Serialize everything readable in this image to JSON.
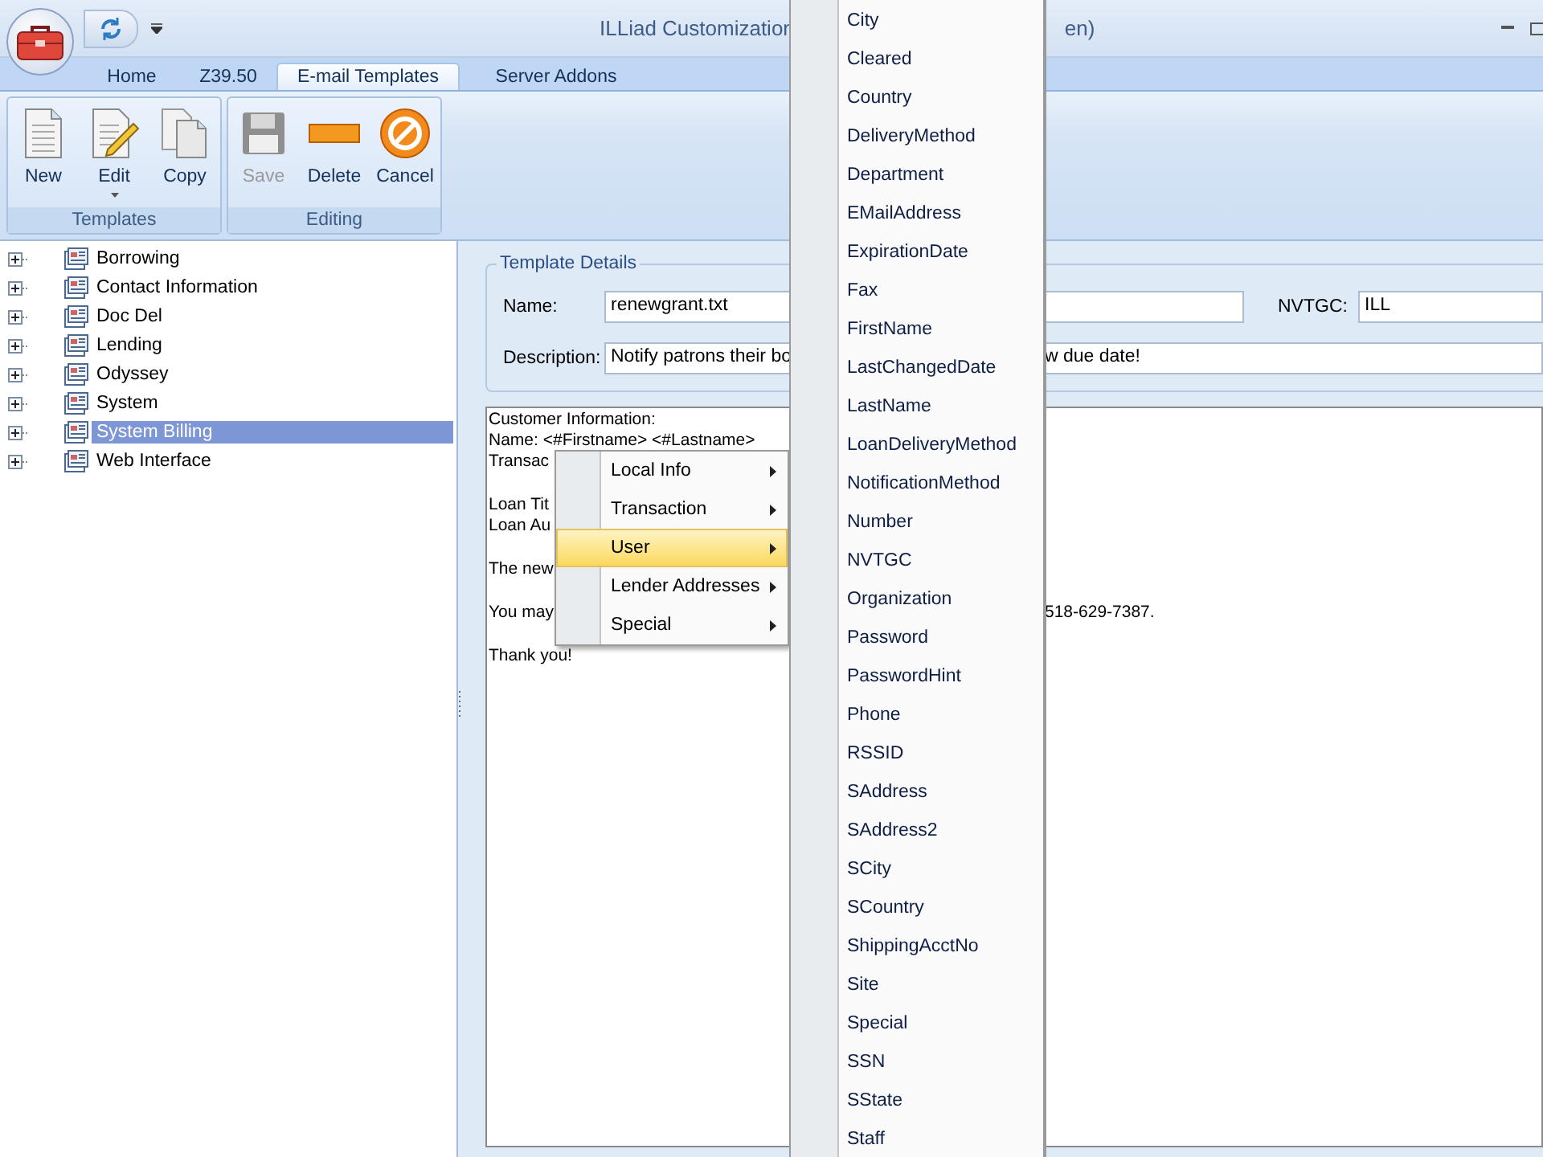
{
  "window": {
    "title": "ILLiad Customization",
    "title_tail": "en)"
  },
  "tabs": [
    {
      "label": "Home",
      "selected": false
    },
    {
      "label": "Z39.50",
      "selected": false
    },
    {
      "label": "E-mail Templates",
      "selected": true
    },
    {
      "label": "Server Addons",
      "selected": false
    }
  ],
  "ribbon": {
    "groups": [
      {
        "label": "Templates",
        "buttons": [
          {
            "label": "New",
            "kind": "new",
            "disabled": false,
            "dropdown": false
          },
          {
            "label": "Edit",
            "kind": "edit",
            "disabled": false,
            "dropdown": true
          },
          {
            "label": "Copy",
            "kind": "copy",
            "disabled": false,
            "dropdown": false
          }
        ]
      },
      {
        "label": "Editing",
        "buttons": [
          {
            "label": "Save",
            "kind": "save",
            "disabled": true,
            "dropdown": false
          },
          {
            "label": "Delete",
            "kind": "delete",
            "disabled": false,
            "dropdown": false
          },
          {
            "label": "Cancel",
            "kind": "cancel",
            "disabled": false,
            "dropdown": false
          }
        ]
      }
    ]
  },
  "tree": [
    {
      "label": "Borrowing",
      "selected": false
    },
    {
      "label": "Contact Information",
      "selected": false
    },
    {
      "label": "Doc Del",
      "selected": false
    },
    {
      "label": "Lending",
      "selected": false
    },
    {
      "label": "Odyssey",
      "selected": false
    },
    {
      "label": "System",
      "selected": false
    },
    {
      "label": "System Billing",
      "selected": true
    },
    {
      "label": "Web Interface",
      "selected": false
    }
  ],
  "template_details": {
    "title": "Template Details",
    "name_label": "Name:",
    "name_value": "renewgrant.txt",
    "nvtgc_label": "NVTGC:",
    "nvtgc_value": "ILL",
    "description_label": "Description:",
    "description_value": "Notify patrons their bo",
    "description_tail": "w due date!"
  },
  "editor": {
    "paragraphs": [
      [
        {
          "text": "Customer Information:"
        },
        {
          "text": "Name: <#Firstname> <#Lastname>"
        },
        {
          "text": "Transac"
        }
      ],
      [
        {
          "text": "Loan Tit"
        },
        {
          "text": "Loan Au"
        }
      ],
      [
        {
          "text": "The new"
        }
      ],
      [
        {
          "text": "You may",
          "tail": "518-629-7387."
        }
      ],
      [
        {
          "text": "Thank you!"
        }
      ]
    ]
  },
  "context_menu": [
    {
      "label": "Local Info",
      "selected": false
    },
    {
      "label": "Transaction",
      "selected": false
    },
    {
      "label": "User",
      "selected": true
    },
    {
      "label": "Lender Addresses",
      "selected": false
    },
    {
      "label": "Special",
      "selected": false
    }
  ],
  "submenu": [
    "City",
    "Cleared",
    "Country",
    "DeliveryMethod",
    "Department",
    "EMailAddress",
    "ExpirationDate",
    "Fax",
    "FirstName",
    "LastChangedDate",
    "LastName",
    "LoanDeliveryMethod",
    "NotificationMethod",
    "Number",
    "NVTGC",
    "Organization",
    "Password",
    "PasswordHint",
    "Phone",
    "RSSID",
    "SAddress",
    "SAddress2",
    "SCity",
    "SCountry",
    "ShippingAcctNo",
    "Site",
    "Special",
    "SSN",
    "SState",
    "Staff"
  ]
}
